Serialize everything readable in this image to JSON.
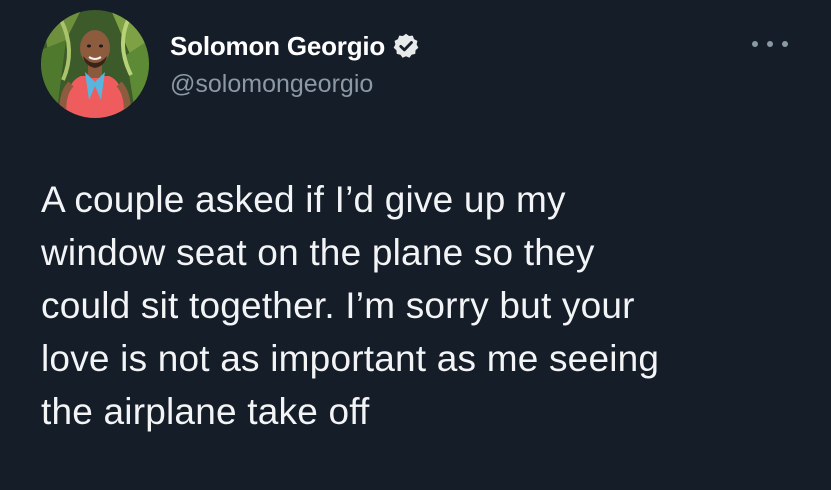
{
  "author": {
    "display_name": "Solomon Georgio",
    "handle": "@solomongeorgio",
    "verified": true,
    "avatar_icon": "profile-photo"
  },
  "tweet": {
    "lines": [
      "A couple asked if I’d give up my",
      "window seat on the plane so they",
      "could sit together. I’m sorry but your",
      "love is not as important as me seeing",
      "the airplane take off"
    ]
  },
  "actions": {
    "more_icon": "more-horizontal-icon"
  },
  "colors": {
    "background": "#151d28",
    "name": "#ffffff",
    "handle": "#8b98a5",
    "text": "#f2f4f5",
    "verified_badge": "#e7e9ea"
  }
}
